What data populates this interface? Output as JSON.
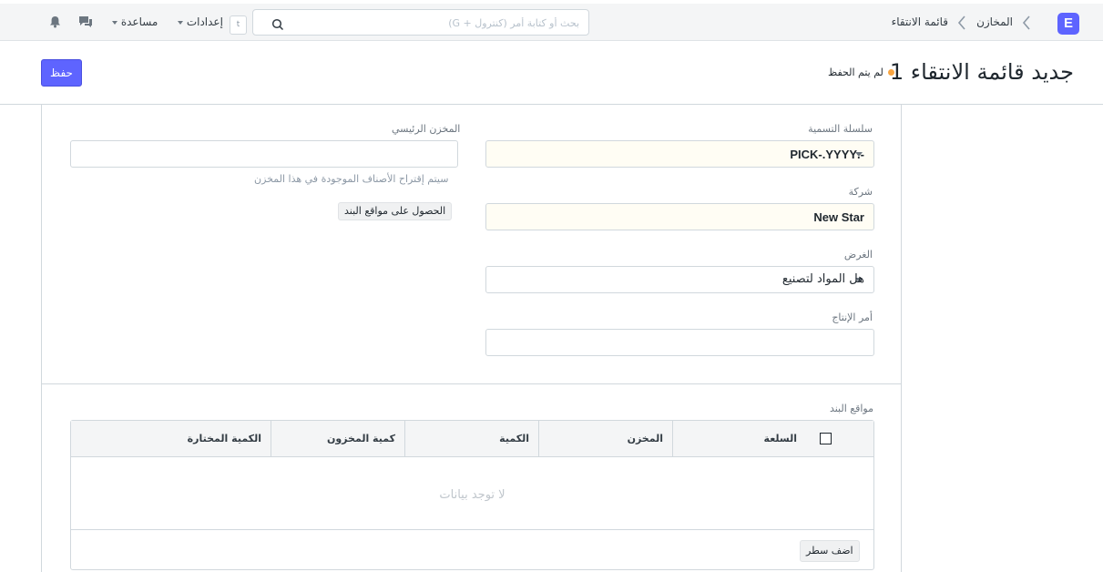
{
  "navbar": {
    "logo": "E",
    "breadcrumbs": [
      "المخازن",
      "قائمة الانتقاء"
    ],
    "search_placeholder": "بحث أو كتابة أمر (كنترول + G)",
    "shortcut_key": "t",
    "settings_label": "إعدادات",
    "help_label": "مساعدة",
    "icons": [
      "chat-icon",
      "bell-icon",
      "search-icon"
    ]
  },
  "page": {
    "title": "جديد قائمة الانتقاء 1",
    "status": "لم يتم الحفظ",
    "status_color": "#f8a542",
    "save_label": "حفظ",
    "accent": "#5e64ff"
  },
  "form": {
    "naming_series": {
      "label": "سلسلة التسمية",
      "value": "-.PICK-.YYYY"
    },
    "company": {
      "label": "شركة",
      "value": "New Star"
    },
    "purpose": {
      "label": "الغرض",
      "value": "هل المواد لتصنيع"
    },
    "work_order": {
      "label": "أمر الإنتاج",
      "value": ""
    },
    "parent_warehouse": {
      "label": "المخزن الرئيسي",
      "value": "",
      "help": "سيتم إقتراح الأصناف الموجودة في هذا المخزن"
    },
    "get_locations_label": "الحصول على مواقع البند"
  },
  "locations": {
    "label": "مواقع البند",
    "columns": [
      "السلعة",
      "المخزن",
      "الكمية",
      "كمية المخزون",
      "الكمية المختارة"
    ],
    "rows": [],
    "empty_text": "لا توجد بيانات",
    "add_row_label": "اضف سطر"
  }
}
